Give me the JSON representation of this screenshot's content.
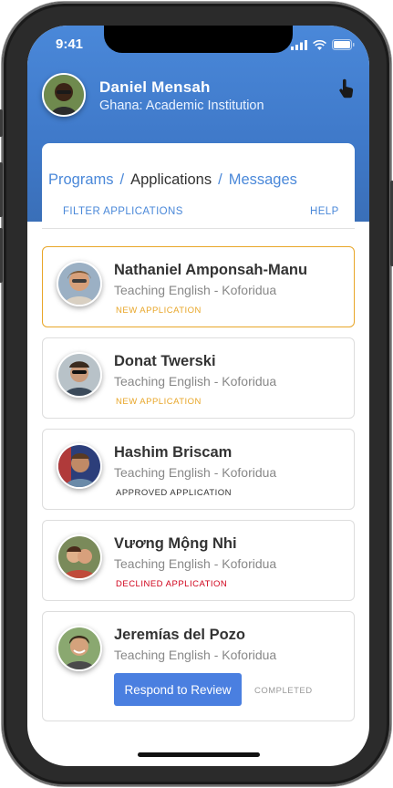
{
  "status_bar": {
    "time": "9:41"
  },
  "profile": {
    "name": "Daniel Mensah",
    "subtitle": "Ghana: Academic Institution"
  },
  "nav": {
    "tabs": [
      {
        "label": "Programs"
      },
      {
        "label": "Applications"
      },
      {
        "label": "Messages"
      }
    ],
    "separator": "/",
    "filter_label": "FILTER APPLICATIONS",
    "help_label": "HELP"
  },
  "applications": [
    {
      "name": "Nathaniel Amponsah-Manu",
      "program": "Teaching English - Koforidua",
      "status": "NEW APPLICATION",
      "status_color": "#e8a628"
    },
    {
      "name": "Donat Twerski",
      "program": "Teaching English - Koforidua",
      "status": "NEW APPLICATION",
      "status_color": "#e8a628"
    },
    {
      "name": "Hashim Briscam",
      "program": "Teaching English - Koforidua",
      "status": "APPROVED APPLICATION",
      "status_color": "#333333"
    },
    {
      "name": "Vương Mộng Nhi",
      "program": "Teaching English - Koforidua",
      "status": "DECLINED APPLICATION",
      "status_color": "#d0021b"
    },
    {
      "name": "Jeremías del Pozo",
      "program": "Teaching English - Koforidua",
      "action_label": "Respond to Review",
      "status": "COMPLETED",
      "status_color": "#999999"
    }
  ],
  "colors": {
    "accent": "#4a88d9",
    "new": "#e8a628",
    "declined": "#d0021b",
    "button": "#4a7fe0"
  }
}
